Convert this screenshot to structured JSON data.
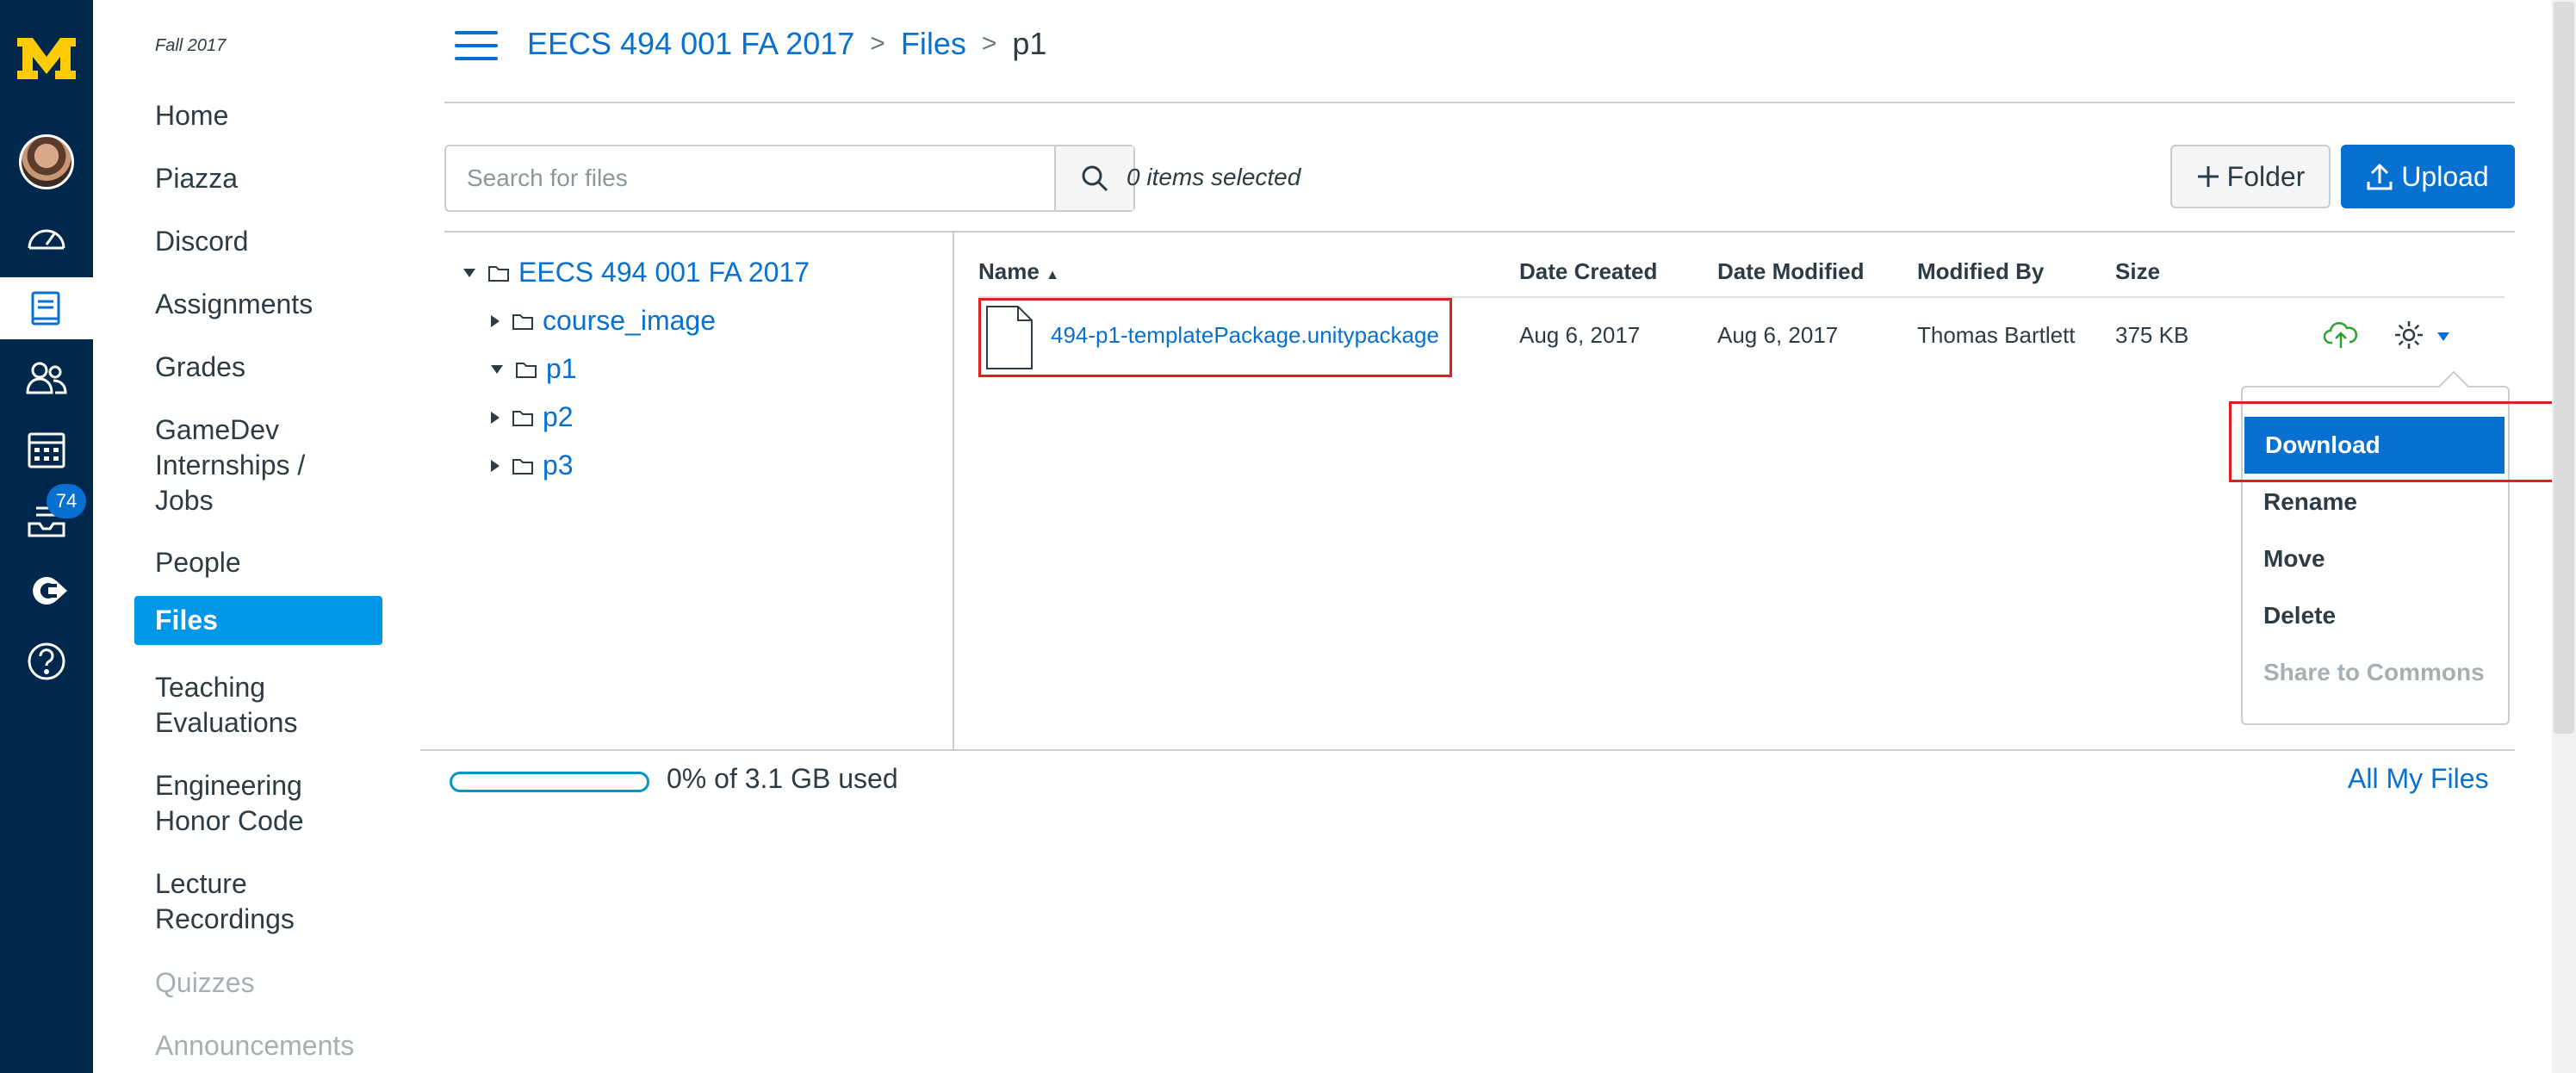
{
  "global_nav": {
    "logo": "M",
    "badge_count": "74",
    "icons": [
      "account-avatar",
      "dashboard-icon",
      "courses-icon",
      "groups-icon",
      "calendar-icon",
      "inbox-icon",
      "logout-icon",
      "help-icon"
    ]
  },
  "course_nav": {
    "term": "Fall 2017",
    "items": [
      {
        "label": "Home"
      },
      {
        "label": "Piazza"
      },
      {
        "label": "Discord"
      },
      {
        "label": "Assignments"
      },
      {
        "label": "Grades"
      },
      {
        "label": "GameDev\nInternships /\nJobs"
      },
      {
        "label": "People"
      },
      {
        "label": "Files"
      },
      {
        "label": "Teaching\nEvaluations"
      },
      {
        "label": "Engineering\nHonor Code"
      },
      {
        "label": "Lecture\nRecordings"
      },
      {
        "label": "Quizzes"
      },
      {
        "label": "Announcements"
      }
    ]
  },
  "breadcrumb": {
    "course": "EECS 494 001 FA 2017",
    "files": "Files",
    "current": "p1",
    "sep": ">"
  },
  "toolbar": {
    "search_placeholder": "Search for files",
    "selected_text": "0 items selected",
    "folder_label": "Folder",
    "upload_label": "Upload"
  },
  "tree": {
    "root": "EECS 494 001 FA 2017",
    "children": [
      {
        "label": "course_image"
      },
      {
        "label": "p1"
      },
      {
        "label": "p2"
      },
      {
        "label": "p3"
      }
    ]
  },
  "table": {
    "headers": {
      "name": "Name",
      "created": "Date Created",
      "modified": "Date Modified",
      "modified_by": "Modified By",
      "size": "Size"
    },
    "rows": [
      {
        "name": "494-p1-templatePackage.unitypackage",
        "created": "Aug 6, 2017",
        "modified": "Aug 6, 2017",
        "modified_by": "Thomas Bartlett",
        "size": "375 KB"
      }
    ]
  },
  "menu": {
    "items": [
      "Download",
      "Rename",
      "Move",
      "Delete",
      "Share to Commons"
    ]
  },
  "footer": {
    "quota_text": "0% of 3.1 GB used",
    "all_files": "All My Files"
  },
  "colors": {
    "nav_bg": "#00274c",
    "logo": "#ffcb05",
    "link": "#0770d0",
    "active": "#0097e8",
    "highlight_box": "#e0201e"
  }
}
